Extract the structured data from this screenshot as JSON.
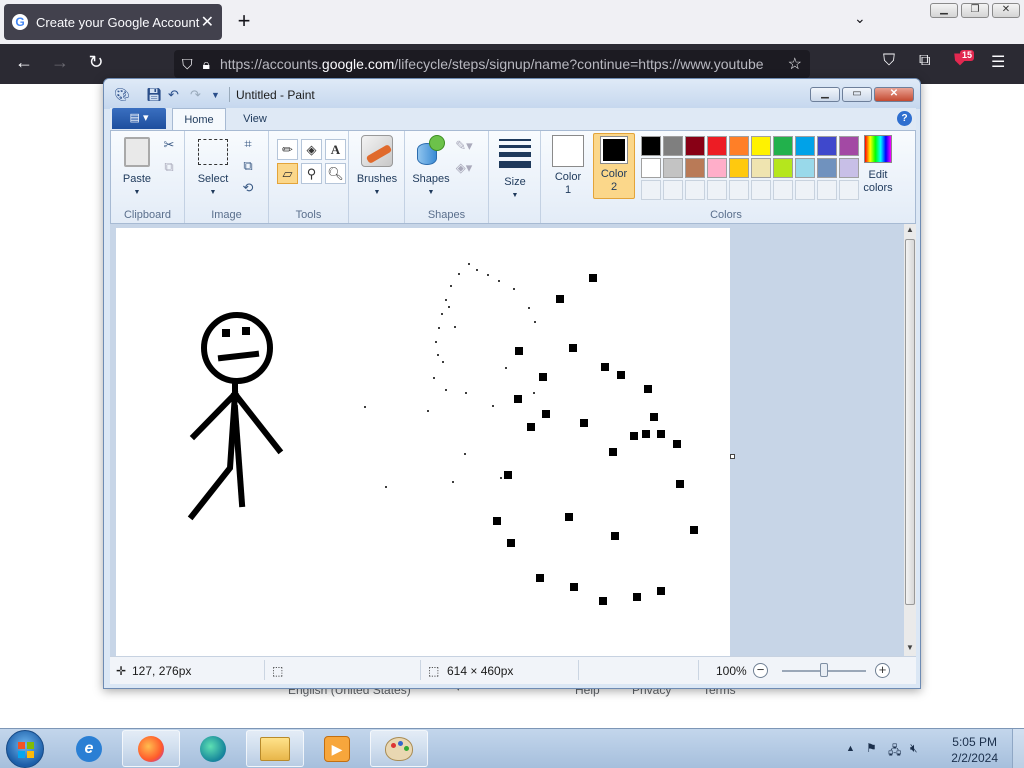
{
  "browser": {
    "tab_title": "Create your Google Account",
    "new_tab_label": "+",
    "url_prefix": "https://accounts.",
    "url_domain": "google.com",
    "url_suffix": "/lifecycle/steps/signup/name?continue=https://www.youtube",
    "badge_count": "15"
  },
  "page_footer": {
    "language": "English (United States)",
    "help": "Help",
    "privacy": "Privacy",
    "terms": "Terms"
  },
  "paint": {
    "window_title": "Untitled - Paint",
    "tabs": {
      "home": "Home",
      "view": "View"
    },
    "groups": {
      "clipboard": "Clipboard",
      "image": "Image",
      "tools": "Tools",
      "shapes": "Shapes",
      "colors": "Colors"
    },
    "buttons": {
      "paste": "Paste",
      "select": "Select",
      "brushes": "Brushes",
      "shapes": "Shapes",
      "size": "Size",
      "color1_line1": "Color",
      "color1_line2": "1",
      "color2_line1": "Color",
      "color2_line2": "2",
      "edit_colors_line1": "Edit",
      "edit_colors_line2": "colors"
    },
    "color1_value": "#ffffff",
    "color2_value": "#000000",
    "palette_row1": [
      "#000000",
      "#7f7f7f",
      "#880015",
      "#ed1c24",
      "#ff7f27",
      "#fff200",
      "#22b14c",
      "#00a2e8",
      "#3f48cc",
      "#a349a4"
    ],
    "palette_row2": [
      "#ffffff",
      "#c3c3c3",
      "#b97a57",
      "#ffaec9",
      "#ffc90e",
      "#efe4b0",
      "#b5e61d",
      "#99d9ea",
      "#7092be",
      "#c8bfe7"
    ],
    "status": {
      "cursor_pos": "127, 276px",
      "canvas_size": "614 × 460px",
      "zoom": "100%",
      "zoom_level": 0.5
    }
  },
  "taskbar": {
    "time": "5:05 PM",
    "date": "2/2/2024"
  }
}
